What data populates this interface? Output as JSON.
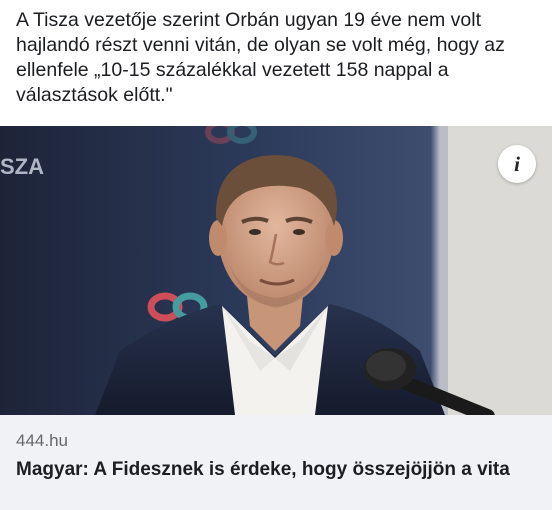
{
  "post": {
    "text": "A Tisza vezetője szerint Orbán ugyan 19 éve nem volt hajlandó részt venni vitán, de olyan se volt még, hogy az ellenfele „10-15 százalékkal vezetett 158 nappal a választások előtt.\""
  },
  "media": {
    "background_sign_text": "SZA",
    "info_icon": "info-icon",
    "info_glyph": "i"
  },
  "link_preview": {
    "domain": "444.hu",
    "title": "Magyar: A Fidesznek is érdeke, hogy összejöjjön a vita"
  },
  "colors": {
    "link_card_bg": "#f0f2f5",
    "domain_text": "#65676b",
    "backdrop_blue": "#2a3652",
    "logo_red": "#e0525b",
    "logo_teal": "#49a8a8"
  }
}
